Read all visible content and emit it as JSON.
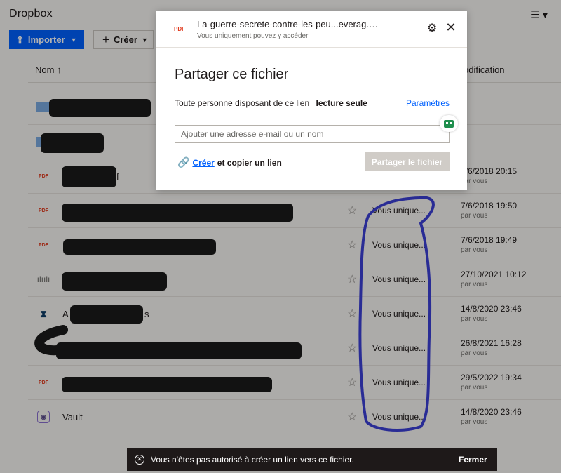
{
  "app": {
    "brand": "Dropbox",
    "menu_icon": "☰ ▾"
  },
  "toolbar": {
    "import_label": "Importer",
    "create_label": "Créer"
  },
  "table": {
    "col_name": "Nom ↑",
    "col_modified": "odification",
    "rows": [
      {
        "type": "folder",
        "name": "",
        "access": "",
        "date": "",
        "by": ""
      },
      {
        "type": "folder",
        "name": "",
        "access": "",
        "date": "",
        "by": ""
      },
      {
        "type": "pdf",
        "icon": "PDF",
        "name": "f",
        "access": "",
        "date": "7/6/2018 20:15",
        "by": "par vous"
      },
      {
        "type": "pdf",
        "icon": "PDF",
        "name": "",
        "access": "Vous unique...",
        "date": "7/6/2018 19:50",
        "by": "par vous"
      },
      {
        "type": "pdf",
        "icon": "PDF",
        "name": "",
        "access": "Vous unique...",
        "date": "7/6/2018 19:49",
        "by": "par vous"
      },
      {
        "type": "audio",
        "icon": "ılıılı",
        "name": "",
        "access": "Vous unique...",
        "date": "27/10/2021 10:12",
        "by": "par vous"
      },
      {
        "type": "app",
        "icon": "⧗",
        "name": "A",
        "name2": "s",
        "access": "Vous unique...",
        "date": "14/8/2020 23:46",
        "by": "par vous"
      },
      {
        "type": "pdf",
        "icon": "PDF",
        "name": "",
        "access": "Vous unique...",
        "date": "26/8/2021 16:28",
        "by": "par vous"
      },
      {
        "type": "pdf",
        "icon": "PDF",
        "name": "",
        "access": "Vous unique...",
        "date": "29/5/2022 19:34",
        "by": "par vous"
      },
      {
        "type": "vault",
        "icon": "◉",
        "name": "Vault",
        "access": "Vous unique...",
        "date": "14/8/2020 23:46",
        "by": "par vous"
      }
    ]
  },
  "modal": {
    "file_icon": "PDF",
    "file_name": "La-guerre-secrete-contre-les-peu...everag.pdf",
    "subtitle": "Vous uniquement pouvez y accéder",
    "gear_icon": "⚙",
    "close_icon": "✕",
    "title": "Partager ce fichier",
    "permission_text": "Toute personne disposant de ce lien",
    "permission_level": "lecture seule",
    "settings_link": "Paramètres",
    "email_placeholder": "Ajouter une adresse e-mail ou un nom",
    "link_icon": "🔗",
    "create_link": "Créer",
    "create_link_rest": "et copier un lien",
    "share_button": "Partager le fichier"
  },
  "toast": {
    "message": "Vous n'êtes pas autorisé à créer un lien vers ce fichier.",
    "close_label": "Fermer"
  },
  "colors": {
    "accent": "#0061fe",
    "scribble": "#3b3fd6",
    "redaction": "#1a1a1a"
  }
}
